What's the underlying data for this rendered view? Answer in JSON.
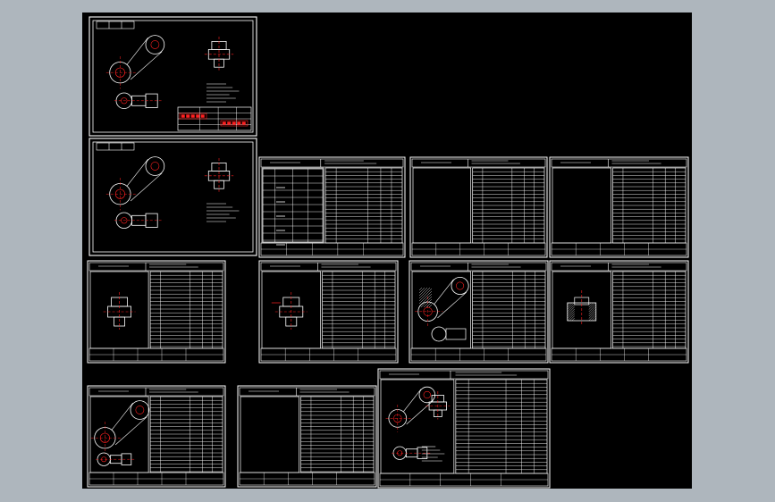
{
  "canvas": {
    "background": "#000000",
    "outer_background": "#aeb6bd",
    "line_color": "#ffffff",
    "accent_color": "#ff2020"
  },
  "sheets": [
    {
      "id": "sheet-assembly",
      "kind": "part-drawing",
      "has_title_stamp": true
    },
    {
      "id": "sheet-blank",
      "kind": "part-drawing",
      "has_title_stamp": false
    },
    {
      "id": "card-r1c1",
      "kind": "process-card",
      "sketch": "table-heavy"
    },
    {
      "id": "card-r1c2",
      "kind": "process-card",
      "sketch": "none"
    },
    {
      "id": "card-r1c3",
      "kind": "process-card",
      "sketch": "none"
    },
    {
      "id": "card-r2c1",
      "kind": "process-card",
      "sketch": "block"
    },
    {
      "id": "card-r2c2",
      "kind": "process-card",
      "sketch": "block-cross"
    },
    {
      "id": "card-r2c3",
      "kind": "process-card",
      "sketch": "lever-arm"
    },
    {
      "id": "card-r2c4",
      "kind": "process-card",
      "sketch": "fixture"
    },
    {
      "id": "card-r3c1",
      "kind": "process-card",
      "sketch": "lever-iso"
    },
    {
      "id": "card-r3c2",
      "kind": "process-card",
      "sketch": "none"
    },
    {
      "id": "card-r3c3",
      "kind": "process-card",
      "sketch": "assembly-mini"
    }
  ]
}
